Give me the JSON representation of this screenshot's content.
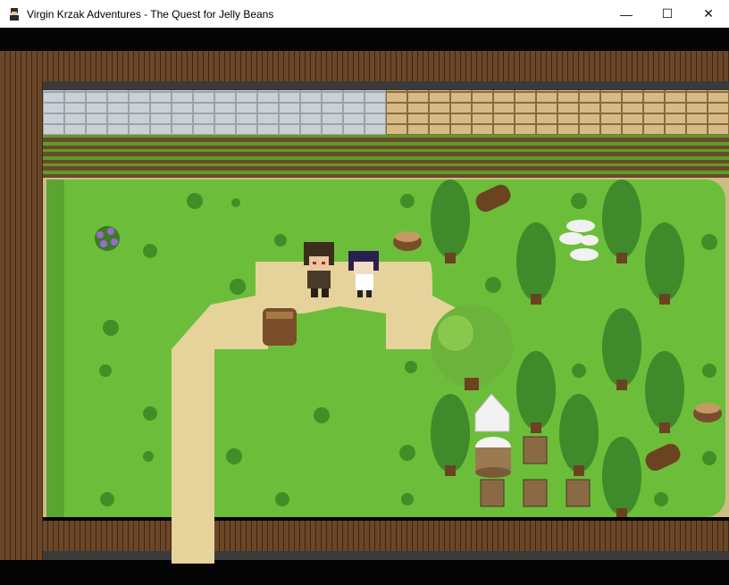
{
  "window": {
    "title": "Virgin Krzak Adventures - The Quest for Jelly Beans",
    "controls": {
      "minimize": "—",
      "maximize": "☐",
      "close": "✕"
    }
  },
  "colors": {
    "grass": "#6cbe3a",
    "grass_dark": "#4f9a2a",
    "path": "#e6d39b",
    "wood": "#6b4728",
    "wood_dark": "#3d2614",
    "stone_gray": "#b9c2c6",
    "stone_tan": "#cdb07c",
    "tree": "#3f8a2a"
  },
  "icons": {
    "app": "game-character-icon",
    "minimize": "minimize-icon",
    "maximize": "maximize-icon",
    "close": "close-icon"
  }
}
